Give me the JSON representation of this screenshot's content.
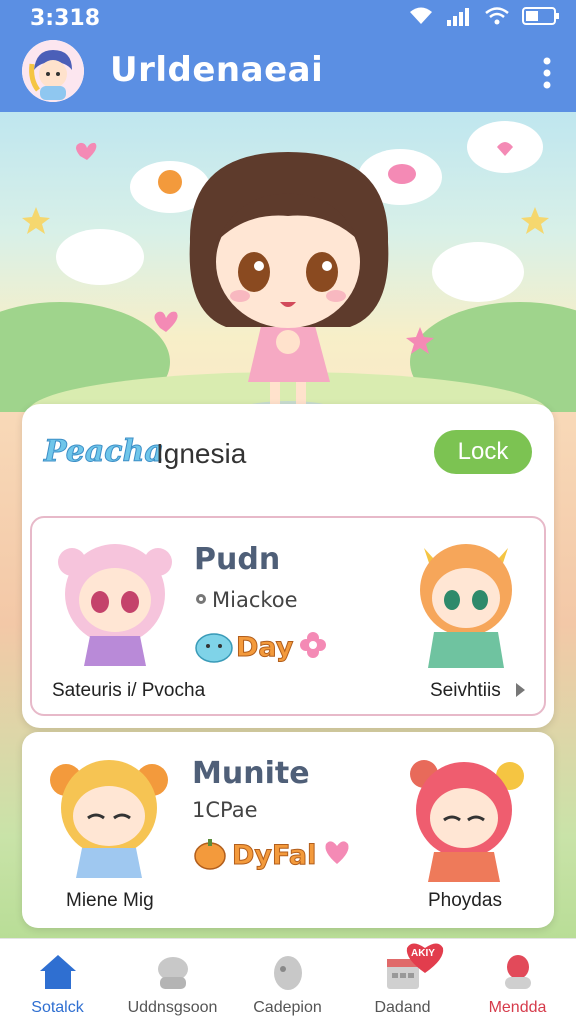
{
  "status_bar": {
    "time": "3:318"
  },
  "app_bar": {
    "title": "Urldenaeai"
  },
  "main_card": {
    "logo": "Peacha",
    "name": "Ignesia",
    "lock_label": "Lock"
  },
  "cards": [
    {
      "title": "Pudn",
      "subtitle": "Miackoe",
      "sub_icon": "gear-icon",
      "tag": "Day",
      "left_label": "Sateuris i/ Pvocha",
      "right_label": "Seivhtiis"
    },
    {
      "title": "Munite",
      "subtitle": "1CPae",
      "tag": "DyFal",
      "left_label": "Miene Mig",
      "right_label": "Phoydas"
    }
  ],
  "nav": {
    "items": [
      {
        "label": "Sotalck",
        "icon": "home-icon",
        "active": true
      },
      {
        "label": "Uddnsgsoon",
        "icon": "toy-icon",
        "active": false
      },
      {
        "label": "Cadepion",
        "icon": "figure-icon",
        "active": false
      },
      {
        "label": "Dadand",
        "icon": "calendar-icon",
        "badge": "AKIY",
        "active": false
      },
      {
        "label": "Mendda",
        "icon": "profile-icon",
        "active": false
      }
    ]
  },
  "colors": {
    "app_bar": "#5b8fe3",
    "accent_green": "#7cc352",
    "active_nav": "#2f6fd1",
    "mendda_label": "#d63b4b"
  }
}
